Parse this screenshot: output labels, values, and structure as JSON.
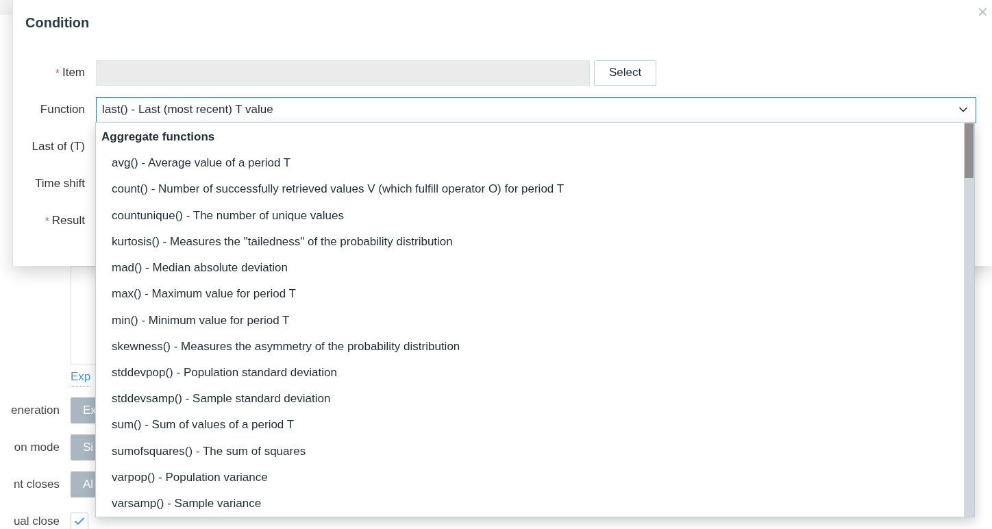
{
  "background_form": {
    "rows": [
      {
        "label": "eneration",
        "button": "Ex"
      },
      {
        "label": "on mode",
        "button": "Si"
      },
      {
        "label": "nt closes",
        "button": "Al"
      }
    ],
    "link": "Exp",
    "manual_close": {
      "label": "ual close",
      "checked": true
    }
  },
  "dialog": {
    "title": "Condition",
    "close": "×",
    "fields": [
      {
        "label": "Item",
        "required_mark": "*"
      },
      {
        "label": "Function"
      },
      {
        "label": "Last of (T)"
      },
      {
        "label": "Time shift"
      },
      {
        "label": "Result",
        "required_mark": "*"
      }
    ],
    "item_button": "Select",
    "function_value": "last() - Last (most recent) T value"
  },
  "dropdown": {
    "group": "Aggregate functions",
    "options": [
      "avg() - Average value of a period T",
      "count() - Number of successfully retrieved values V (which fulfill operator O) for period T",
      "countunique() - The number of unique values",
      "kurtosis() - Measures the \"tailedness\" of the probability distribution",
      "mad() - Median absolute deviation",
      "max() - Maximum value for period T",
      "min() - Minimum value for period T",
      "skewness() - Measures the asymmetry of the probability distribution",
      "stddevpop() - Population standard deviation",
      "stddevsamp() - Sample standard deviation",
      "sum() - Sum of values of a period T",
      "sumofsquares() - The sum of squares",
      "varpop() - Population variance",
      "varsamp() - Sample variance"
    ]
  }
}
